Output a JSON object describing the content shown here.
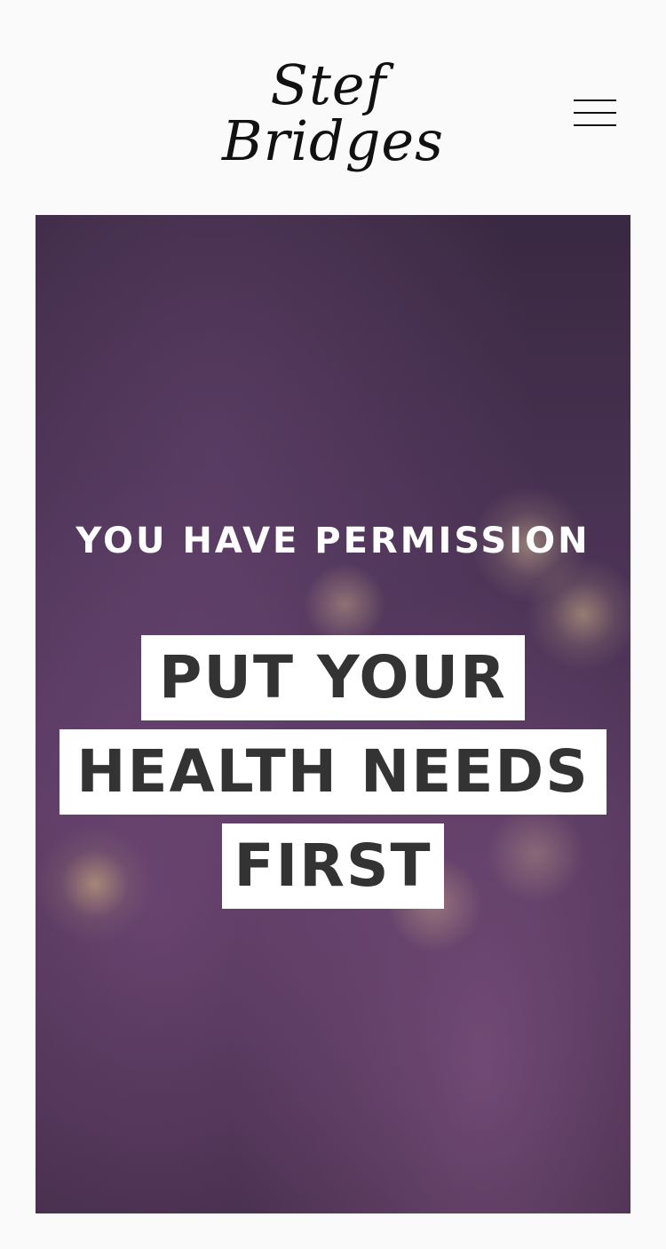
{
  "header": {
    "logo": {
      "line1": "Stef",
      "line2": "Bridges"
    },
    "menu_icon": "hamburger-menu-icon"
  },
  "hero": {
    "background": "purple-heather-flowers-bokeh-photo",
    "eyebrow": "YOU HAVE PERMISSION",
    "headline": {
      "line1": "PUT YOUR",
      "line2": "HEALTH NEEDS",
      "line3": "FIRST"
    }
  },
  "colors": {
    "page_background": "#fafafa",
    "headline_text": "#333333",
    "headline_box": "#ffffff",
    "eyebrow_text": "#ffffff",
    "logo_text": "#111111"
  }
}
